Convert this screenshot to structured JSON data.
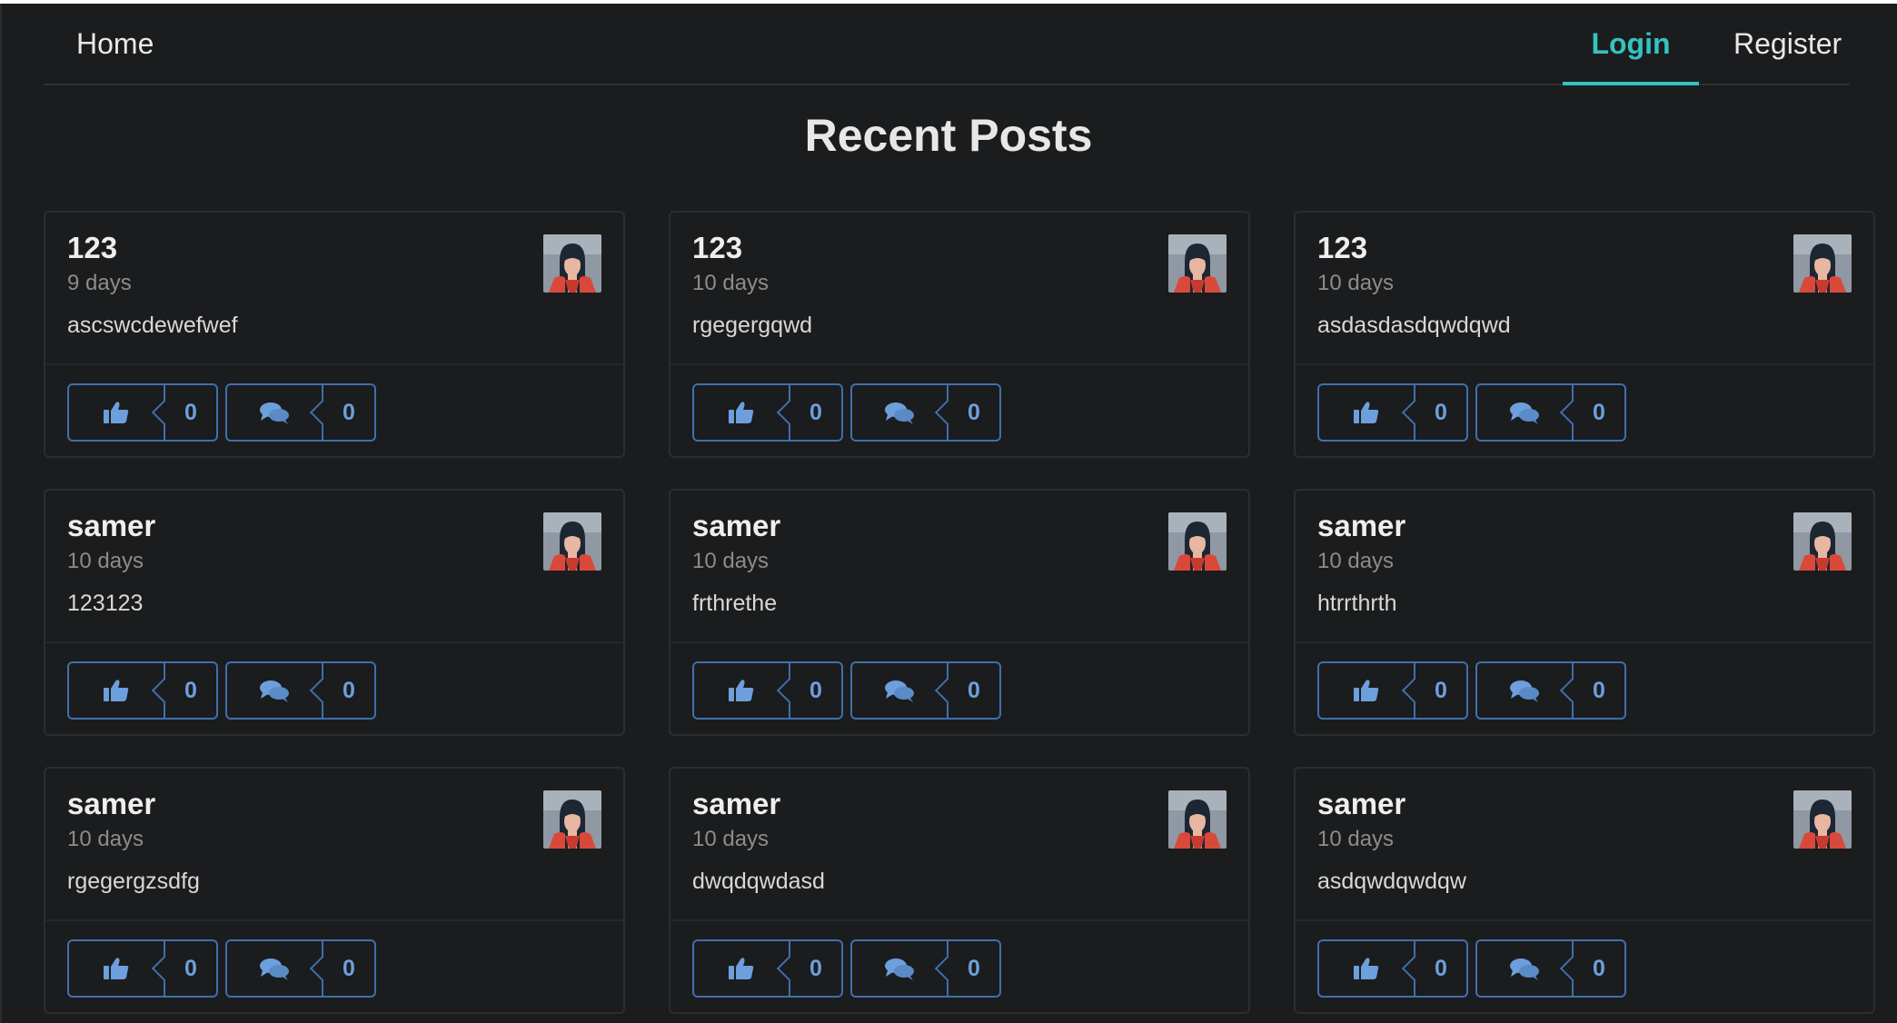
{
  "nav": {
    "home_label": "Home",
    "login_label": "Login",
    "register_label": "Register",
    "accent_color": "#35c2c2"
  },
  "page": {
    "title": "Recent Posts"
  },
  "posts": [
    {
      "author": "123",
      "time": "9 days",
      "text": "ascswcdewefwef",
      "likes": "0",
      "comments": "0"
    },
    {
      "author": "123",
      "time": "10 days",
      "text": "rgegergqwd",
      "likes": "0",
      "comments": "0"
    },
    {
      "author": "123",
      "time": "10 days",
      "text": "asdasdasdqwdqwd",
      "likes": "0",
      "comments": "0"
    },
    {
      "author": "samer",
      "time": "10 days",
      "text": "123123",
      "likes": "0",
      "comments": "0"
    },
    {
      "author": "samer",
      "time": "10 days",
      "text": "frthrethe",
      "likes": "0",
      "comments": "0"
    },
    {
      "author": "samer",
      "time": "10 days",
      "text": "htrrthrth",
      "likes": "0",
      "comments": "0"
    },
    {
      "author": "samer",
      "time": "10 days",
      "text": "rgegergzsdfg",
      "likes": "0",
      "comments": "0"
    },
    {
      "author": "samer",
      "time": "10 days",
      "text": "dwqdqwdasd",
      "likes": "0",
      "comments": "0"
    },
    {
      "author": "samer",
      "time": "10 days",
      "text": "asdqwdqwdqw",
      "likes": "0",
      "comments": "0"
    }
  ],
  "icons": {
    "like": "thumbs-up-icon",
    "comment": "comments-icon",
    "avatar": "user-avatar"
  },
  "colors": {
    "background": "#1b1c1d",
    "action_border": "#3f6fae",
    "action_text": "#6d9fdc"
  }
}
